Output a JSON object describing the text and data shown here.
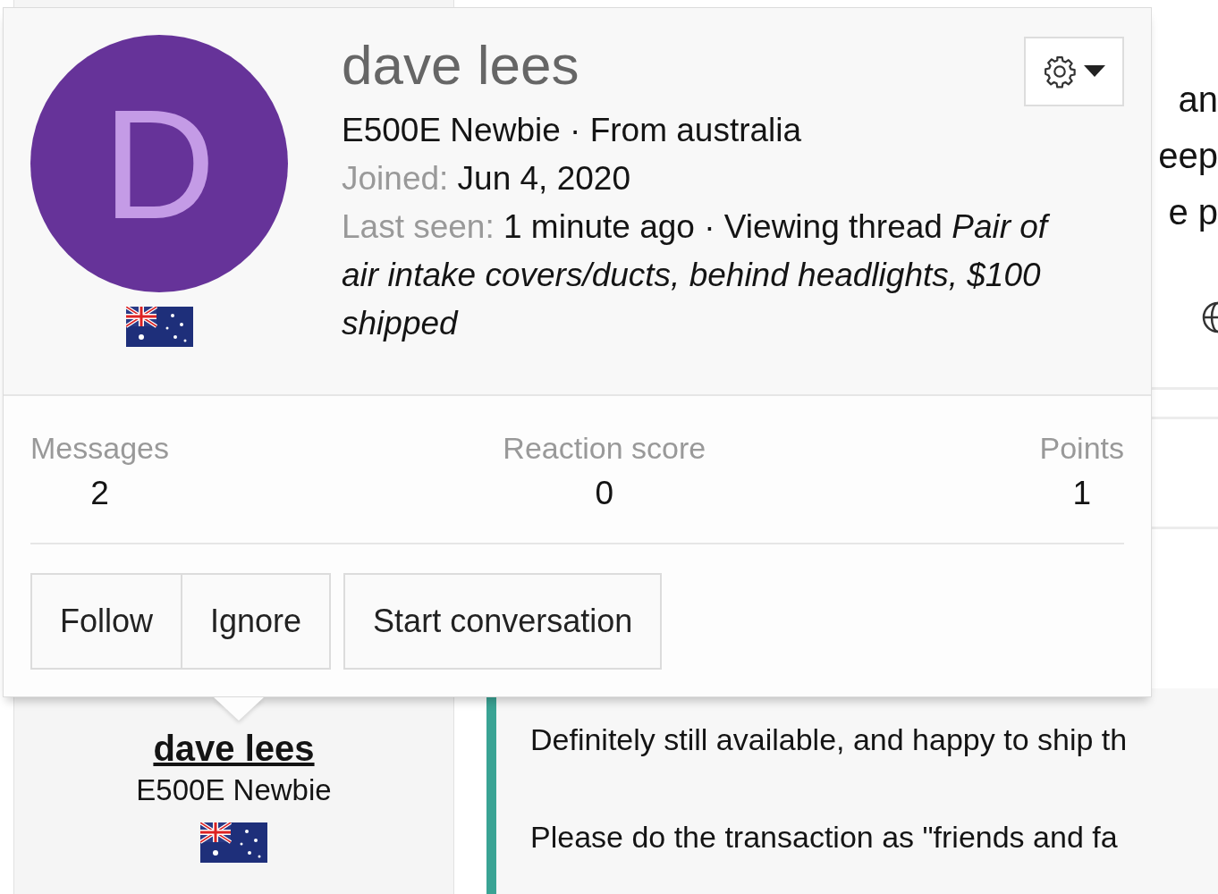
{
  "background_thread": {
    "edge_fragments": [
      "an",
      "eep",
      "e p"
    ],
    "author": {
      "name": "dave lees",
      "title": "E500E Newbie"
    },
    "post_paragraphs": [
      "Definitely still available, and happy to ship th",
      "Please do the transaction as \"friends and fa"
    ]
  },
  "profile_popup": {
    "avatar_letter": "D",
    "name": "dave lees",
    "subtitle": "E500E Newbie · From australia",
    "joined": {
      "label": "Joined:",
      "value": "Jun 4, 2020"
    },
    "last_seen": {
      "label": "Last seen:",
      "value": "1 minute ago · Viewing thread *Pair of air intake covers/ducts, behind headlights, $100 shipped*"
    },
    "stats": [
      {
        "label": "Messages",
        "value": "2"
      },
      {
        "label": "Reaction score",
        "value": "0"
      },
      {
        "label": "Points",
        "value": "1"
      }
    ],
    "button_groups": [
      [
        "Follow",
        "Ignore"
      ],
      [
        "Start conversation"
      ]
    ]
  }
}
